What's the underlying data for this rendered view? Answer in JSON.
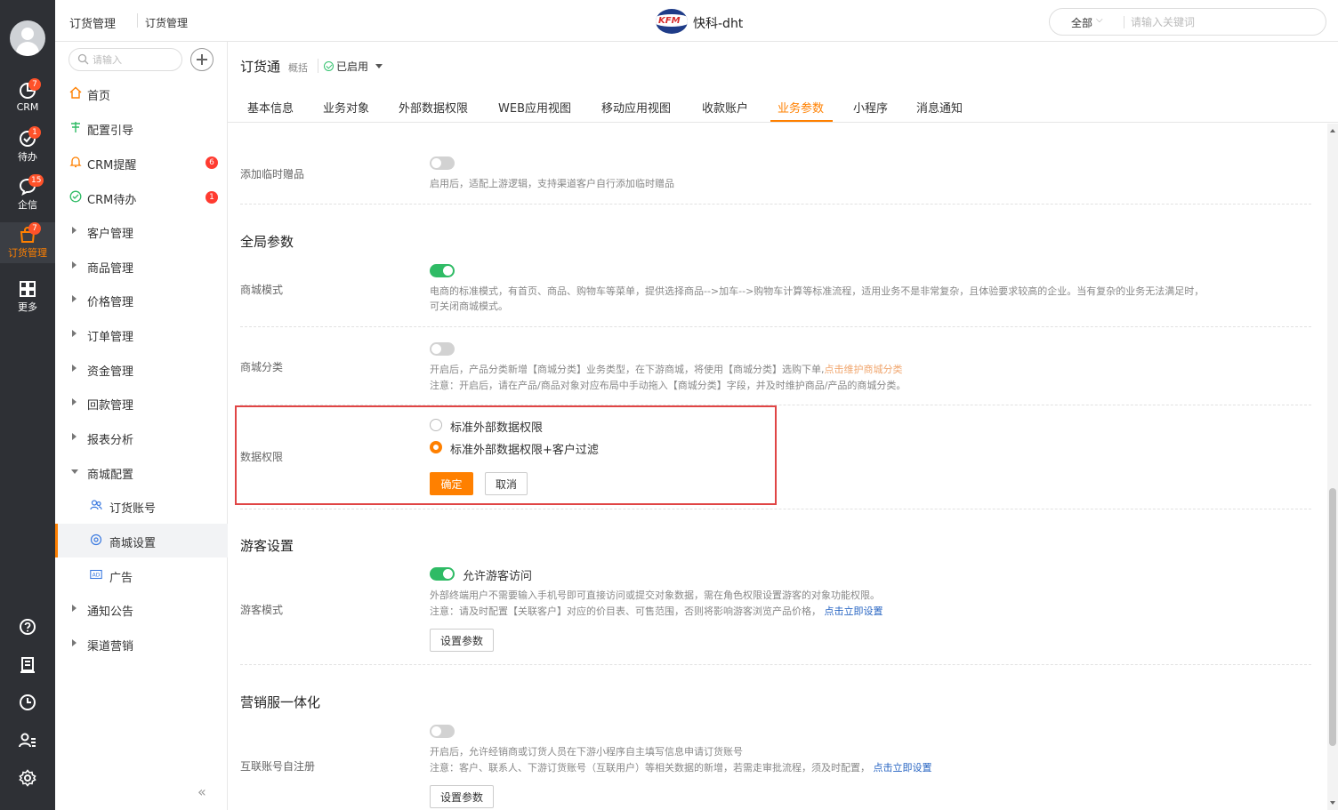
{
  "rail": {
    "items": [
      {
        "label": "CRM",
        "badge": "7"
      },
      {
        "label": "待办",
        "badge": "1"
      },
      {
        "label": "企信",
        "badge": "15"
      },
      {
        "label": "订货管理",
        "badge": "7"
      },
      {
        "label": "更多",
        "badge": ""
      }
    ]
  },
  "topbar": {
    "crumb1": "订货管理",
    "crumb2": "订货管理",
    "brand_logo_text": "KFM",
    "brand_title": "快科-dht",
    "search_scope": "全部",
    "search_placeholder": "请输入关键词"
  },
  "sidebar": {
    "search_placeholder": "请输入",
    "items": [
      {
        "label": "首页"
      },
      {
        "label": "配置引导"
      },
      {
        "label": "CRM提醒",
        "badge": "6"
      },
      {
        "label": "CRM待办",
        "badge": "1"
      },
      {
        "label": "客户管理"
      },
      {
        "label": "商品管理"
      },
      {
        "label": "价格管理"
      },
      {
        "label": "订单管理"
      },
      {
        "label": "资金管理"
      },
      {
        "label": "回款管理"
      },
      {
        "label": "报表分析"
      },
      {
        "label": "商城配置"
      },
      {
        "label": "订货账号"
      },
      {
        "label": "商城设置"
      },
      {
        "label": "广告"
      },
      {
        "label": "通知公告"
      },
      {
        "label": "渠道营销"
      }
    ],
    "collapse_glyph": "«"
  },
  "header": {
    "app_title": "订货通",
    "app_sub": "概括",
    "status": "已启用"
  },
  "tabs": [
    {
      "label": "基本信息"
    },
    {
      "label": "业务对象"
    },
    {
      "label": "外部数据权限"
    },
    {
      "label": "WEB应用视图"
    },
    {
      "label": "移动应用视图"
    },
    {
      "label": "收款账户"
    },
    {
      "label": "业务参数",
      "active": true
    },
    {
      "label": "小程序"
    },
    {
      "label": "消息通知"
    }
  ],
  "settings": {
    "temp_gift": {
      "label": "添加临时赠品",
      "enabled": false,
      "desc": "启用后，适配上游逻辑，支持渠道客户自行添加临时赠品"
    },
    "global_title": "全局参数",
    "mall_mode": {
      "label": "商城模式",
      "enabled": true,
      "desc1": "电商的标准模式，有首页、商品、购物车等菜单，提供选择商品-->加车-->购物车计算等标准流程，适用业务不是非常复杂，且体验要求较高的企业。当有复杂的业务无法满足时，",
      "desc2": "可关闭商城模式。"
    },
    "mall_category": {
      "label": "商城分类",
      "enabled": false,
      "desc1": "开启后，产品分类新增【商城分类】业务类型，在下游商城，将使用【商城分类】选购下单,",
      "desc1_link": "点击维护商城分类",
      "desc2": "注意：开启后，请在产品/商品对象对应布局中手动拖入【商城分类】字段，并及时维护商品/产品的商城分类。"
    },
    "data_permission": {
      "label": "数据权限",
      "options": [
        "标准外部数据权限",
        "标准外部数据权限+客户过滤"
      ],
      "selected_index": 1,
      "confirm": "确定",
      "cancel": "取消"
    },
    "guest_title": "游客设置",
    "guest_mode": {
      "label": "游客模式",
      "enabled": true,
      "toggle_text": "允许游客访问",
      "desc1": "外部终端用户不需要输入手机号即可直接访问或提交对象数据，需在角色权限设置游客的对象功能权限。",
      "desc2": "注意：请及时配置【关联客户】对应的价目表、可售范围，否则将影响游客浏览产品价格，",
      "desc2_link": "点击立即设置",
      "button": "设置参数"
    },
    "marketing_title": "营销服一体化",
    "self_register": {
      "label": "互联账号自注册",
      "enabled": false,
      "desc1": "开启后，允许经销商或订货人员在下游小程序自主填写信息申请订货账号",
      "desc2": "注意：客户、联系人、下游订货账号（互联用户）等相关数据的新增，若需走审批流程，须及时配置，",
      "desc2_link": "点击立即设置",
      "button": "设置参数"
    }
  }
}
